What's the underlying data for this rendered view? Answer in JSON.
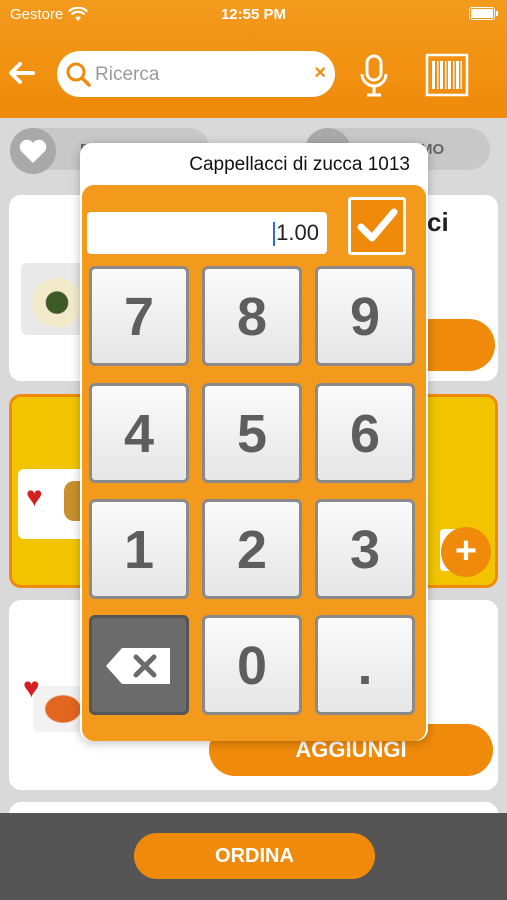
{
  "status_bar": {
    "carrier": "Gestore",
    "time": "12:55 PM"
  },
  "search": {
    "placeholder": "Ricerca",
    "clear": "×"
  },
  "filters": [
    {
      "label": "P"
    },
    {
      "label": "MO"
    }
  ],
  "cards": [
    {
      "title_fragment": "ci"
    },
    {
      "button": "AGGIUNGI"
    }
  ],
  "dialog": {
    "title": "Cappellacci di zucca 1013",
    "quantity": "1.00",
    "keys": [
      "7",
      "8",
      "9",
      "4",
      "5",
      "6",
      "1",
      "2",
      "3",
      "backspace",
      "0",
      "."
    ]
  },
  "bottom": {
    "order_button": "ORDINA"
  },
  "colors": {
    "accent": "#f08a0a",
    "highlight": "#f2c400",
    "bar": "#555555"
  }
}
